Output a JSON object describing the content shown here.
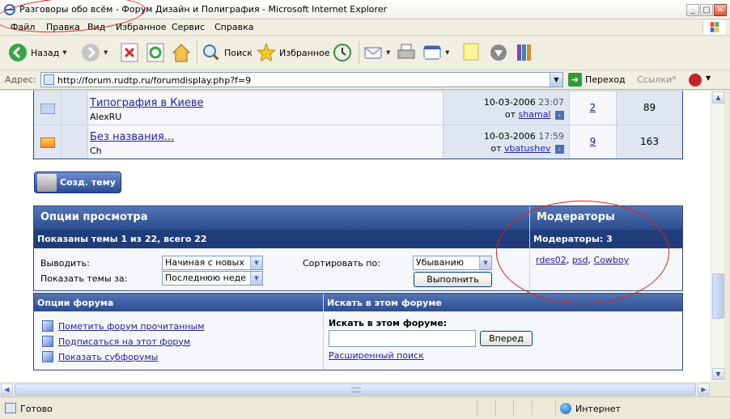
{
  "window": {
    "title": "Разговоры обо всём - Форум Дизайн и Полиграфия - Microsoft Internet Explorer",
    "minimize": "_",
    "maximize": "□",
    "close": "✕"
  },
  "menu": {
    "items": [
      "Файл",
      "Правка",
      "Вид",
      "Избранное",
      "Сервис",
      "Справка"
    ]
  },
  "toolbar": {
    "back_label": "Назад",
    "search_label": "Поиск",
    "favorites_label": "Избранное",
    "icons": [
      "back-icon",
      "forward-icon",
      "stop-icon",
      "refresh-icon",
      "home-icon",
      "search-icon",
      "favorites-icon",
      "history-icon",
      "mail-icon",
      "print-icon",
      "edit-icon",
      "notes-icon",
      "messenger-icon",
      "research-icon"
    ]
  },
  "address": {
    "label": "Адрес:",
    "url": "http://forum.rudtp.ru/forumdisplay.php?f=9",
    "go_label": "Переход",
    "links_label": "Ссылки",
    "links_chevron": "»"
  },
  "threads": [
    {
      "title": "Типография в Киеве",
      "author": "AlexRU",
      "last_date": "10-03-2006",
      "last_time": "23:07",
      "last_by_prefix": "от",
      "last_by": "shamal",
      "replies": "2",
      "views": "89",
      "hot": false
    },
    {
      "title": "Без названия...",
      "author": "Ch",
      "last_date": "10-03-2006",
      "last_time": "17:59",
      "last_by_prefix": "от",
      "last_by": "vbatushev",
      "replies": "9",
      "views": "163",
      "hot": true
    }
  ],
  "new_thread_button": "Созд. тему",
  "display_options": {
    "header": "Опции просмотра",
    "subheader": "Показаны темы 1 из 22, всего 22",
    "show_label": "Выводить:",
    "show_value": "Начиная с новых",
    "period_label": "Показать темы за:",
    "period_value": "Последнюю неде",
    "sort_label": "Сортировать по:",
    "sort_value": "Убыванию",
    "submit_label": "Выполнить"
  },
  "moderators": {
    "header": "Модераторы",
    "subheader": "Модераторы: 3",
    "names": [
      "rdes02",
      "psd",
      "Cowboy"
    ],
    "separator": ", "
  },
  "forum_tools": {
    "header": "Опции форума",
    "links": [
      "Пометить форум прочитанным",
      "Подписаться на этот форум",
      "Показать субфорумы"
    ]
  },
  "search_forum": {
    "header": "Искать в этом форуме",
    "label": "Искать в этом форуме:",
    "input_value": "",
    "submit_label": "Вперед",
    "advanced_label": "Расширенный поиск"
  },
  "status": {
    "text": "Готово",
    "zone": "Интернет"
  },
  "colors": {
    "annotation": "#e0201e",
    "forum_header": "#2c4d8e",
    "link": "#22229c"
  }
}
